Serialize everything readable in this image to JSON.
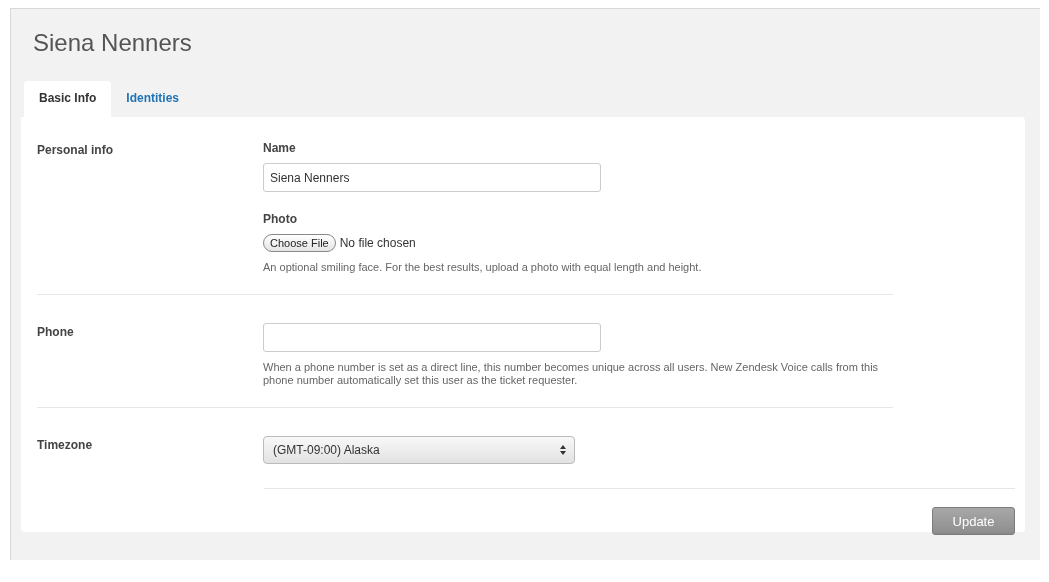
{
  "title": "Siena Nenners",
  "tabs": [
    {
      "label": "Basic Info",
      "selected": true
    },
    {
      "label": "Identities",
      "selected": false
    }
  ],
  "sections": [
    {
      "label": "Personal info",
      "fields": [
        {
          "kind": "text",
          "label": "Name",
          "value": "Siena Nenners"
        },
        {
          "kind": "file",
          "label": "Photo",
          "button": "Choose File",
          "status": "No file chosen",
          "hint": "An optional smiling face. For the best results, upload a photo with equal length and height."
        }
      ]
    },
    {
      "label": "Phone",
      "fields": [
        {
          "kind": "text",
          "hint": "When a phone number is set as a direct line, this number becomes unique across all users. New Zendesk Voice calls from this phone number automatically set this user as the ticket requester."
        }
      ]
    },
    {
      "label": "Timezone",
      "fields": [
        {
          "kind": "select",
          "value": "(GMT-09:00) Alaska"
        }
      ]
    }
  ],
  "submit": {
    "label": "Update",
    "disabled": true
  }
}
